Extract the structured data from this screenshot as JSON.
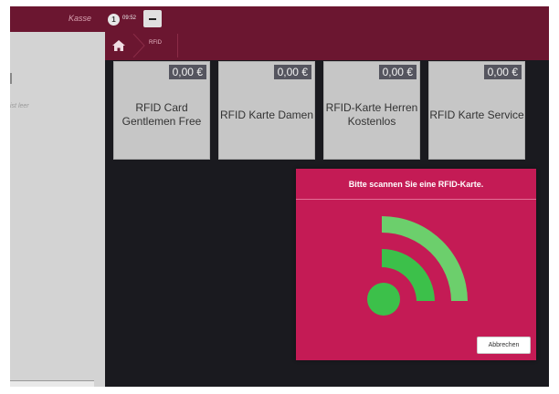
{
  "header": {
    "kasse_label": "Kasse",
    "badge_count": "1",
    "clock": "09:52"
  },
  "breadcrumb": {
    "current": "RFID"
  },
  "cart": {
    "empty_text": "ist leer"
  },
  "tiles": [
    {
      "name": "RFID Card Gentlemen Free",
      "price": "0,00 €"
    },
    {
      "name": "RFID Karte Damen",
      "price": "0,00 €"
    },
    {
      "name": "RFID-Karte Herren Kostenlos",
      "price": "0,00 €"
    },
    {
      "name": "RFID Karte Service",
      "price": "0,00 €"
    }
  ],
  "modal": {
    "title": "Bitte scannen Sie eine RFID-Karte.",
    "cancel_label": "Abbrechen"
  },
  "colors": {
    "header": "#6b1630",
    "modal": "#c41b55",
    "rfid_green": "#3cc04a",
    "tile": "#c6c6c6"
  },
  "icons": {
    "home": "home-icon",
    "rfid": "rfid-signal-icon"
  }
}
